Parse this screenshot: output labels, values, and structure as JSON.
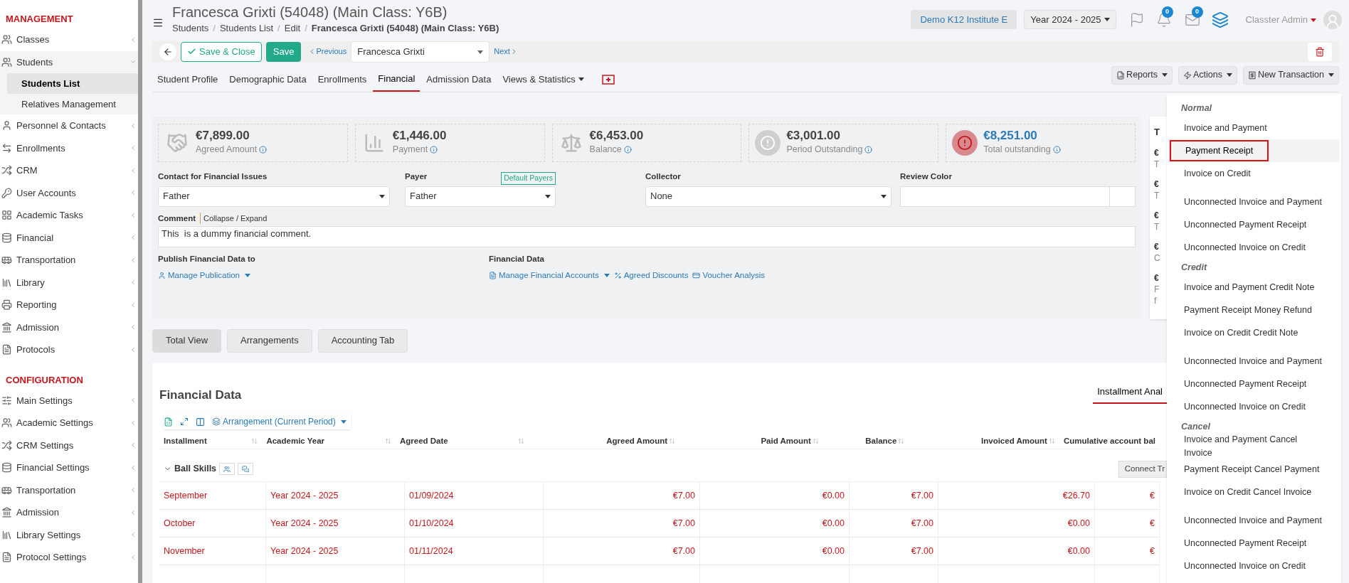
{
  "sidebar": {
    "sections": [
      {
        "title": "MANAGEMENT",
        "items": [
          {
            "label": "Classes",
            "selected": false,
            "expanded": false
          },
          {
            "label": "Students",
            "selected": false,
            "expanded": true,
            "children": [
              {
                "label": "Students List",
                "selected": true
              },
              {
                "label": "Relatives Management",
                "selected": false
              }
            ]
          },
          {
            "label": "Personnel & Contacts",
            "selected": false,
            "expanded": false
          },
          {
            "label": "Enrollments",
            "selected": false,
            "expanded": false
          },
          {
            "label": "CRM",
            "selected": false,
            "expanded": false
          },
          {
            "label": "User Accounts",
            "selected": false,
            "expanded": false
          },
          {
            "label": "Academic Tasks",
            "selected": false,
            "expanded": false
          },
          {
            "label": "Financial",
            "selected": false,
            "expanded": false
          },
          {
            "label": "Transportation",
            "selected": false,
            "expanded": false
          },
          {
            "label": "Library",
            "selected": false,
            "expanded": false
          },
          {
            "label": "Reporting",
            "selected": false,
            "expanded": false
          },
          {
            "label": "Admission",
            "selected": false,
            "expanded": false
          },
          {
            "label": "Protocols",
            "selected": false,
            "expanded": false
          }
        ]
      },
      {
        "title": "CONFIGURATION",
        "items": [
          {
            "label": "Main Settings",
            "selected": false,
            "expanded": false
          },
          {
            "label": "Academic Settings",
            "selected": false,
            "expanded": false
          },
          {
            "label": "CRM Settings",
            "selected": false,
            "expanded": false
          },
          {
            "label": "Financial Settings",
            "selected": false,
            "expanded": false
          },
          {
            "label": "Transportation",
            "selected": false,
            "expanded": false
          },
          {
            "label": "Admission",
            "selected": false,
            "expanded": false
          },
          {
            "label": "Library Settings",
            "selected": false,
            "expanded": false
          },
          {
            "label": "Protocol Settings",
            "selected": false,
            "expanded": false
          }
        ]
      }
    ]
  },
  "header": {
    "title": "Francesca Grixti (54048) (Main Class: Y6B)",
    "breadcrumbs": [
      "Students",
      "Students List",
      "Edit"
    ],
    "separator": "/",
    "breadcrumb_current": "Francesca Grixti (54048) (Main Class: Y6B)",
    "institute": "Demo K12 Institute E",
    "year": "Year 2024 - 2025",
    "notifications": "0",
    "messages": "0",
    "user": "Classter Admin"
  },
  "toolbar": {
    "save_close": "Save & Close",
    "save": "Save",
    "previous": "Previous",
    "student": "Francesca Grixti",
    "next": "Next"
  },
  "tabs": [
    {
      "label": "Student Profile",
      "selected": false
    },
    {
      "label": "Demographic Data",
      "selected": false
    },
    {
      "label": "Enrollments",
      "selected": false
    },
    {
      "label": "Financial",
      "selected": true
    },
    {
      "label": "Admission Data",
      "selected": false
    },
    {
      "label": "Views & Statistics",
      "selected": false
    }
  ],
  "actions": [
    "Reports",
    "Actions",
    "New Transaction"
  ],
  "stats": [
    {
      "value": "€7,899.00",
      "label": "Agreed Amount",
      "highlight": false
    },
    {
      "value": "€1,446.00",
      "label": "Payment",
      "highlight": false
    },
    {
      "value": "€6,453.00",
      "label": "Balance",
      "highlight": false
    },
    {
      "value": "€3,001.00",
      "label": "Period Outstanding",
      "highlight": false
    },
    {
      "value": "€8,251.00",
      "label": "Total outstanding",
      "highlight": true
    }
  ],
  "fields": {
    "contact": {
      "label": "Contact for Financial Issues",
      "value": "Father"
    },
    "payer": {
      "label": "Payer",
      "value": "Father",
      "badge": "Default Payers"
    },
    "collector": {
      "label": "Collector",
      "value": "None"
    },
    "review_color": {
      "label": "Review Color"
    },
    "comment": {
      "label": "Comment",
      "toggle": "Collapse / Expand",
      "value": "This  is a dummy financial comment."
    }
  },
  "publish": {
    "label": "Publish Financial Data to",
    "link": "Manage Publication"
  },
  "financial_links": {
    "label": "Financial Data",
    "links": [
      "Manage Financial Accounts",
      "Agreed Discounts",
      "Voucher Analysis"
    ]
  },
  "side_card": {
    "heading": "T",
    "lines": [
      [
        "€",
        "T"
      ],
      [
        "€",
        "T"
      ],
      [
        "€",
        "T"
      ],
      [
        "€",
        "C"
      ],
      [
        "€",
        "F",
        "f"
      ]
    ]
  },
  "subtabs": [
    {
      "label": "Total View",
      "selected": true
    },
    {
      "label": "Arrangements",
      "selected": false
    },
    {
      "label": "Accounting Tab",
      "selected": false
    }
  ],
  "financial_data": {
    "title": "Financial Data",
    "view_tab": "Installment Anal",
    "arrangement": "Arrangement (Current Period)",
    "connect": "Connect Tr",
    "columns": [
      "Installment",
      "Academic Year",
      "Agreed Date",
      "Agreed Amount",
      "Paid Amount",
      "Balance",
      "Invoiced Amount",
      "Cumulative account bal"
    ],
    "group": "Ball Skills",
    "rows": [
      [
        "September",
        "Year 2024 - 2025",
        "01/09/2024",
        "€7.00",
        "€0.00",
        "€7.00",
        "€26.70",
        "€"
      ],
      [
        "October",
        "Year 2024 - 2025",
        "01/10/2024",
        "€7.00",
        "€0.00",
        "€7.00",
        "€0.00",
        "€"
      ],
      [
        "November",
        "Year 2024 - 2025",
        "01/11/2024",
        "€7.00",
        "€0.00",
        "€7.00",
        "€0.00",
        "€"
      ]
    ]
  },
  "menu": {
    "groups": [
      {
        "title": "Normal",
        "items": [
          {
            "label": "Invoice and Payment",
            "selected": false
          },
          {
            "label": "Payment Receipt",
            "selected": true
          },
          {
            "label": "Invoice on Credit",
            "selected": false
          }
        ]
      },
      {
        "items": [
          {
            "label": "Unconnected Invoice and Payment",
            "selected": false
          },
          {
            "label": "Unconnected Payment Receipt",
            "selected": false
          },
          {
            "label": "Unconnected Invoice on Credit",
            "selected": false
          }
        ]
      },
      {
        "title": "Credit",
        "items": [
          {
            "label": "Invoice and Payment Credit Note",
            "selected": false
          },
          {
            "label": "Payment Receipt Money Refund",
            "selected": false
          },
          {
            "label": "Invoice on Credit Credit Note",
            "selected": false
          }
        ]
      },
      {
        "items": [
          {
            "label": "Unconnected Invoice and Payment",
            "selected": false
          },
          {
            "label": "Unconnected Payment Receipt",
            "selected": false
          },
          {
            "label": "Unconnected Invoice on Credit",
            "selected": false
          }
        ]
      },
      {
        "title": "Cancel",
        "items": [
          {
            "label": "Invoice and Payment Cancel Invoice",
            "selected": false
          },
          {
            "label": "Payment Receipt Cancel Payment",
            "selected": false
          },
          {
            "label": "Invoice on Credit Cancel Invoice",
            "selected": false
          }
        ]
      },
      {
        "items": [
          {
            "label": "Unconnected Invoice and Payment",
            "selected": false
          },
          {
            "label": "Unconnected Payment Receipt",
            "selected": false
          },
          {
            "label": "Unconnected Invoice on Credit",
            "selected": false
          }
        ]
      }
    ]
  }
}
